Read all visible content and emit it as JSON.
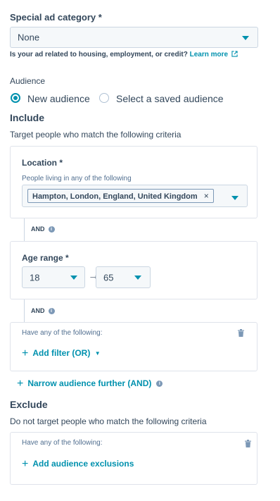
{
  "special_ad": {
    "label": "Special ad category *",
    "selected": "None",
    "help_text": "Is your ad related to housing, employment, or credit?",
    "learn_more": "Learn more"
  },
  "audience": {
    "label": "Audience",
    "options": [
      "New audience",
      "Select a saved audience"
    ],
    "selected_index": 0
  },
  "include": {
    "heading": "Include",
    "description": "Target people who match the following criteria",
    "location": {
      "label": "Location *",
      "sublabel": "People living in any of the following",
      "tag": "Hampton, London, England, United Kingdom",
      "tag_remove": "×"
    },
    "and_label_1": "AND",
    "age": {
      "label": "Age range *",
      "min": "18",
      "max": "65",
      "arrow": "→"
    },
    "and_label_2": "AND",
    "filter_card": {
      "sublabel": "Have any of the following:",
      "add_filter": "Add filter (OR)"
    },
    "narrow": "Narrow audience further (AND)"
  },
  "exclude": {
    "heading": "Exclude",
    "description": "Do not target people who match the following criteria",
    "sublabel": "Have any of the following:",
    "add_exclusions": "Add audience exclusions"
  },
  "colors": {
    "accent": "#0091ae",
    "text": "#33475b",
    "border": "#dfe3eb"
  }
}
